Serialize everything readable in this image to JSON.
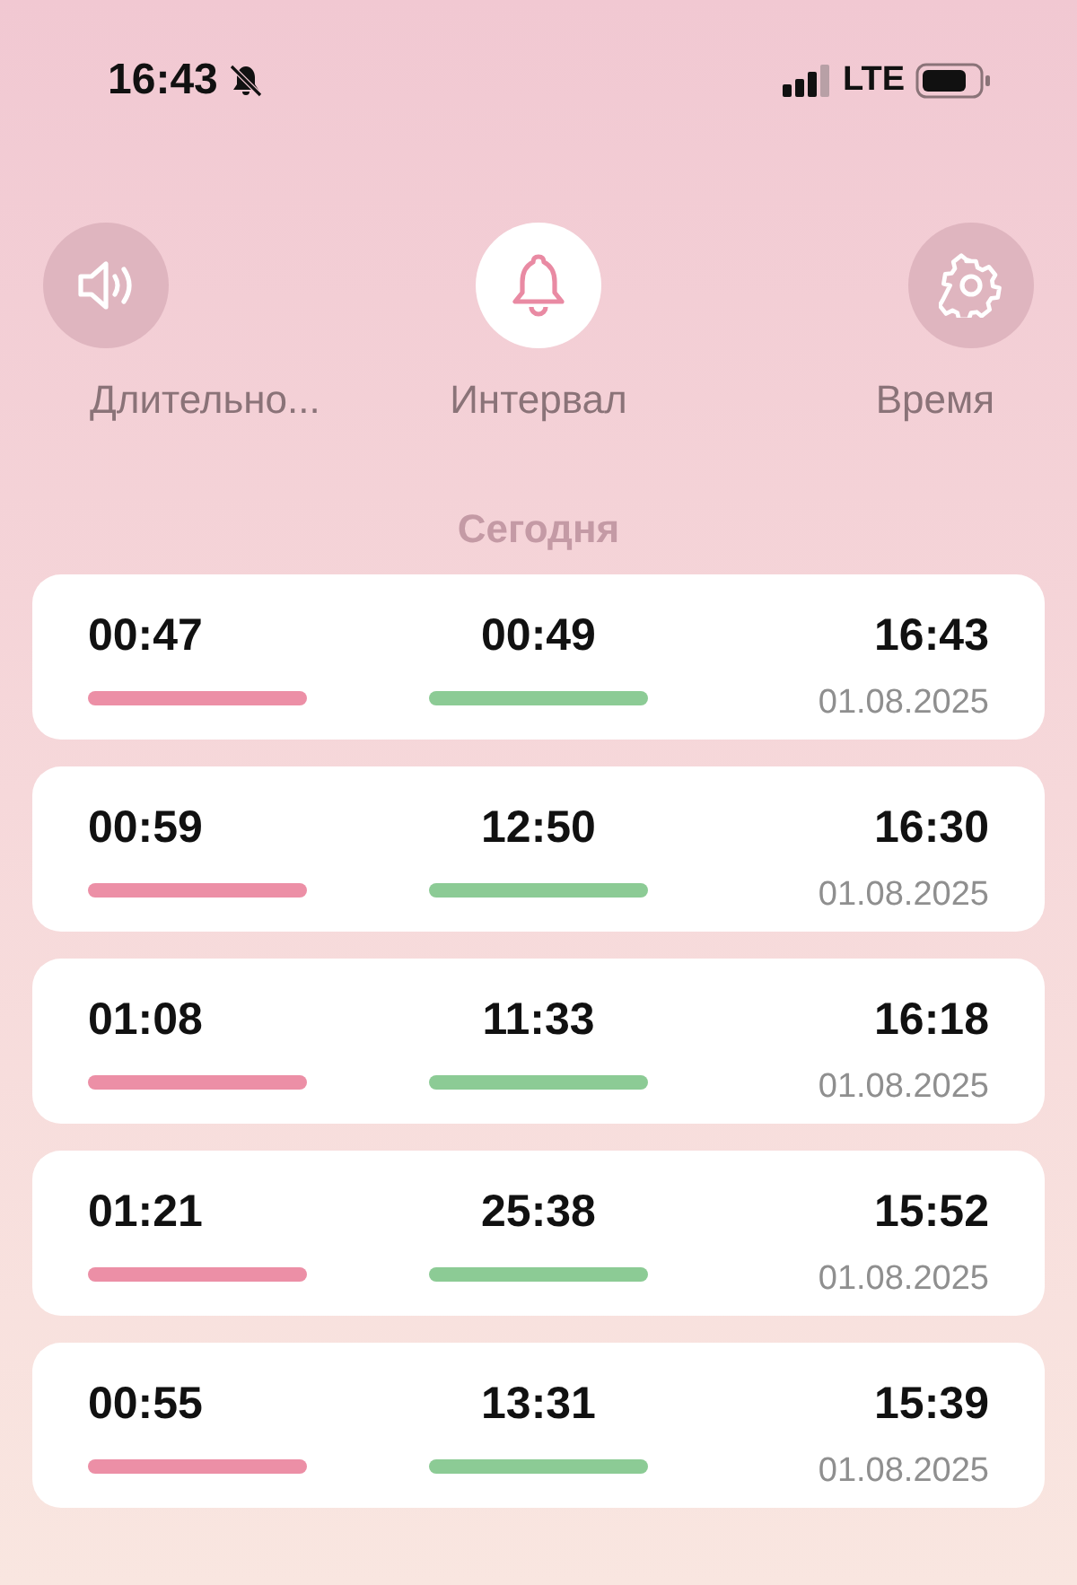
{
  "status_bar": {
    "time": "16:43",
    "network": "LTE"
  },
  "modes": [
    {
      "kind": "sound",
      "label": "Длительно...",
      "selected": false
    },
    {
      "kind": "bell",
      "label": "Интервал",
      "selected": true
    },
    {
      "kind": "gear",
      "label": "Время",
      "selected": false
    }
  ],
  "section_title": "Сегодня",
  "records": [
    {
      "duration": "00:47",
      "interval": "00:49",
      "time": "16:43",
      "date": "01.08.2025"
    },
    {
      "duration": "00:59",
      "interval": "12:50",
      "time": "16:30",
      "date": "01.08.2025"
    },
    {
      "duration": "01:08",
      "interval": "11:33",
      "time": "16:18",
      "date": "01.08.2025"
    },
    {
      "duration": "01:21",
      "interval": "25:38",
      "time": "15:52",
      "date": "01.08.2025"
    },
    {
      "duration": "00:55",
      "interval": "13:31",
      "time": "15:39",
      "date": "01.08.2025"
    }
  ]
}
